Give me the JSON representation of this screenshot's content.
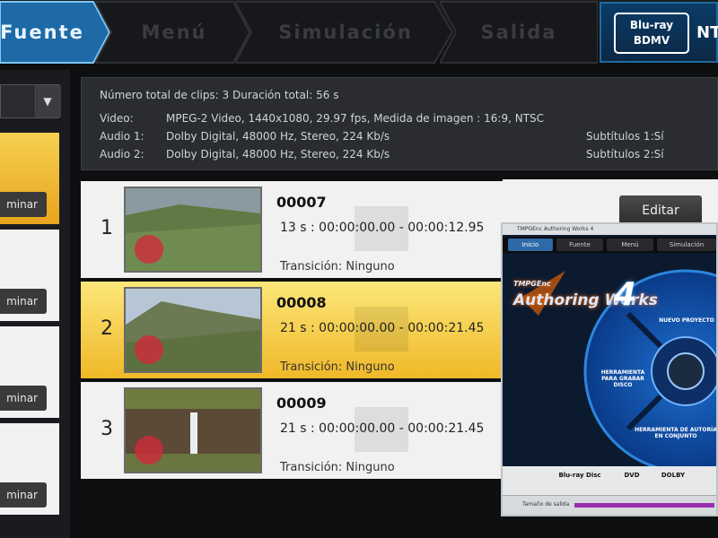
{
  "nav": {
    "tabs": [
      {
        "label": "Fuente"
      },
      {
        "label": "Menú"
      },
      {
        "label": "Simulación"
      },
      {
        "label": "Salida"
      }
    ],
    "disc_logo": "Blu-ray BDMV",
    "format": "NTSC"
  },
  "info": {
    "summary": "Número total de clips: 3    Duración total: 56 s",
    "video_label": "Video:",
    "video_value": "MPEG-2 Video,  1440x1080,  29.97 fps,  Medida de imagen : 16:9,  NTSC",
    "audio1_label": "Audio 1:",
    "audio1_value": "Dolby Digital,  48000 Hz,  Stereo,  224 Kb/s",
    "audio2_label": "Audio 2:",
    "audio2_value": "Dolby Digital,  48000 Hz,  Stereo,  224 Kb/s",
    "subs1": "Subtítulos 1:Sí",
    "subs2": "Subtítulos 2:Sí"
  },
  "sidebar": {
    "remove_label": "minar"
  },
  "clips": [
    {
      "index": "1",
      "name": "00007",
      "duration": "13 s :  00:00:00.00 - 00:00:12.95",
      "transition": "Transición: Ninguno",
      "selected": false
    },
    {
      "index": "2",
      "name": "00008",
      "duration": "21 s :  00:00:00.00 - 00:00:21.45",
      "transition": "Transición: Ninguno",
      "selected": true
    },
    {
      "index": "3",
      "name": "00009",
      "duration": "21 s :  00:00:00.00 - 00:00:21.45",
      "transition": "Transición: Ninguno",
      "selected": false
    }
  ],
  "edit_label": "Editar",
  "overlay": {
    "title": "TMPGEnc Authoring Works 4",
    "tabs": [
      "Inicio",
      "Fuente",
      "Menú",
      "Simulación"
    ],
    "brand_small": "TMPGEnc",
    "brand_big": "Authoring Works",
    "version": "4",
    "new_project": "NUEVO PROYECTO",
    "tool_disc": "HERRAMIENTA PARA GRABAR DISCO",
    "tool_auth": "HERRAMIENTA DE AUTORÍA EN CONJUNTO",
    "logos": [
      "Blu-ray Disc",
      "DVD",
      "DOLBY"
    ],
    "status_text": "Tamaño de salida"
  },
  "colors": {
    "selected_row": "#f0b828",
    "active_tab": "#1d6aa6",
    "overlay_bg": "#0c1a30"
  }
}
